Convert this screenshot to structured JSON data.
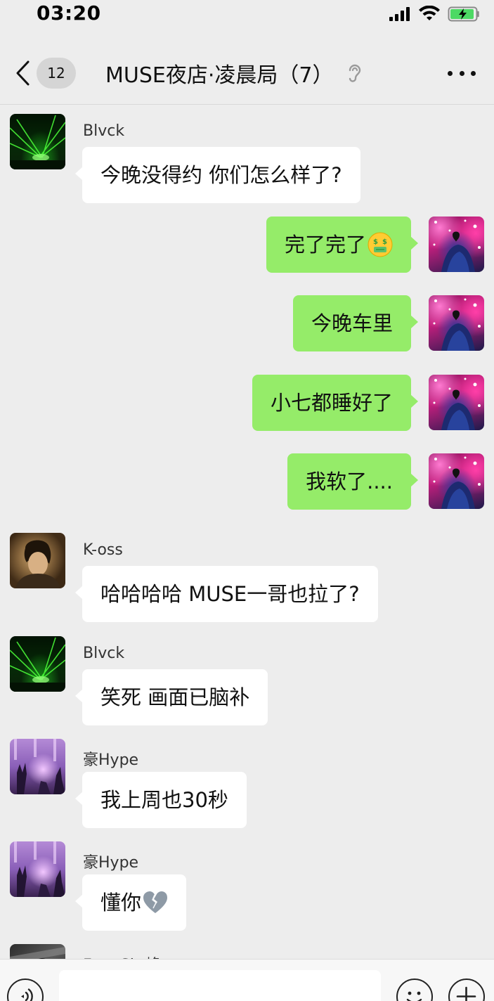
{
  "status_bar": {
    "time": "03:20",
    "icons": [
      "signal-icon",
      "wifi-icon",
      "battery-charging-icon"
    ]
  },
  "nav": {
    "unread_count": "12",
    "title": "MUSE夜店·凌晨局（7）",
    "icons": [
      "back-chevron-icon",
      "earpiece-icon",
      "more-icon"
    ]
  },
  "messages": [
    {
      "side": "left",
      "sender": "Blvck",
      "text": "今晚没得约 你们怎么样了?",
      "avatar": "laser"
    },
    {
      "side": "right",
      "sender": "",
      "text": "完了完了",
      "emoji": "money-mouth-face",
      "avatar": "self"
    },
    {
      "side": "right",
      "sender": "",
      "text": "今晚车里",
      "avatar": "self"
    },
    {
      "side": "right",
      "sender": "",
      "text": "小七都睡好了",
      "avatar": "self"
    },
    {
      "side": "right",
      "sender": "",
      "text": "我软了....",
      "avatar": "self"
    },
    {
      "side": "left",
      "sender": "K-oss",
      "text": "哈哈哈哈 MUSE一哥也拉了?",
      "avatar": "kos"
    },
    {
      "side": "left",
      "sender": "Blvck",
      "text": "笑死 画面已脑补",
      "avatar": "laser"
    },
    {
      "side": "left",
      "sender": "豪Hype",
      "text": "我上周也30秒",
      "avatar": "hype"
    },
    {
      "side": "left",
      "sender": "豪Hype",
      "text": "懂你",
      "emoji": "broken-heart",
      "avatar": "hype"
    },
    {
      "side": "left",
      "sender": "FengSkr峰",
      "text": "",
      "avatar": "feng"
    }
  ],
  "input_bar": {
    "placeholder": "",
    "icons": [
      "voice-icon",
      "emoji-face-icon",
      "plus-icon"
    ]
  },
  "colors": {
    "background": "#ededed",
    "self_bubble": "#95ec69",
    "other_bubble": "#ffffff",
    "battery_green": "#4cd964"
  }
}
